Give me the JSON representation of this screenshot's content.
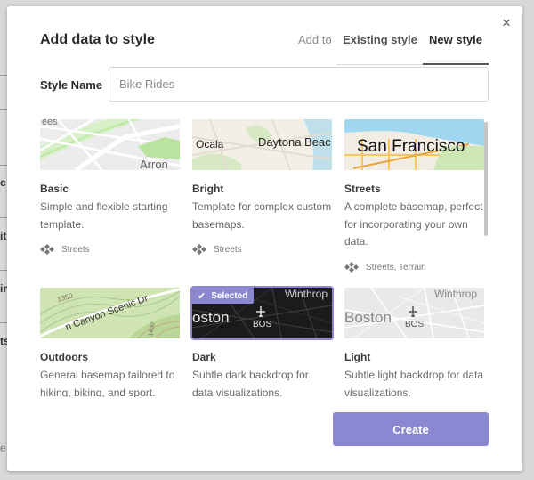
{
  "background": {
    "fragments": [
      "c",
      "it",
      "in",
      "ts",
      "e"
    ]
  },
  "modal": {
    "title": "Add data to style",
    "close_glyph": "×",
    "tabs": {
      "prefix": "Add to",
      "items": [
        {
          "label": "Existing style",
          "active": false
        },
        {
          "label": "New style",
          "active": true
        }
      ]
    },
    "style_name": {
      "label": "Style Name",
      "value": "",
      "placeholder": "Bike Rides"
    },
    "styles": [
      {
        "name": "Basic",
        "description": "Simple and flexible starting template.",
        "source": "Streets",
        "map_label": "Arron",
        "map_label2": "ees",
        "icon": "streets-source-icon",
        "selected": false
      },
      {
        "name": "Bright",
        "description": "Template for complex custom basemaps.",
        "source": "Streets",
        "map_label": "Daytona Beac",
        "map_label2": "Ocala",
        "icon": "streets-source-icon",
        "selected": false
      },
      {
        "name": "Streets",
        "description": "A complete basemap, perfect for incorporating your own data.",
        "source": "Streets, Terrain",
        "map_label": "San Francisco",
        "icon": "streets-terrain-source-icon",
        "selected": false
      },
      {
        "name": "Outdoors",
        "description": "General basemap tailored to hiking, biking, and sport.",
        "map_label": "n Canyon Scenic Dr",
        "map_label2": "1350",
        "map_label3": "1400",
        "selected": false
      },
      {
        "name": "Dark",
        "description": "Subtle dark backdrop for data visualizations.",
        "map_label": "oston",
        "map_label2": "Winthrop",
        "map_label3": "BOS",
        "selected": true,
        "badge": "Selected"
      },
      {
        "name": "Light",
        "description": "Subtle light backdrop for data visualizations.",
        "map_label": "Boston",
        "map_label2": "Winthrop",
        "map_label3": "BOS",
        "selected": false
      }
    ],
    "create_label": "Create"
  },
  "colors": {
    "accent": "#8c87d1",
    "text_primary": "#2b2b2b",
    "text_muted": "#6a6a6a"
  }
}
